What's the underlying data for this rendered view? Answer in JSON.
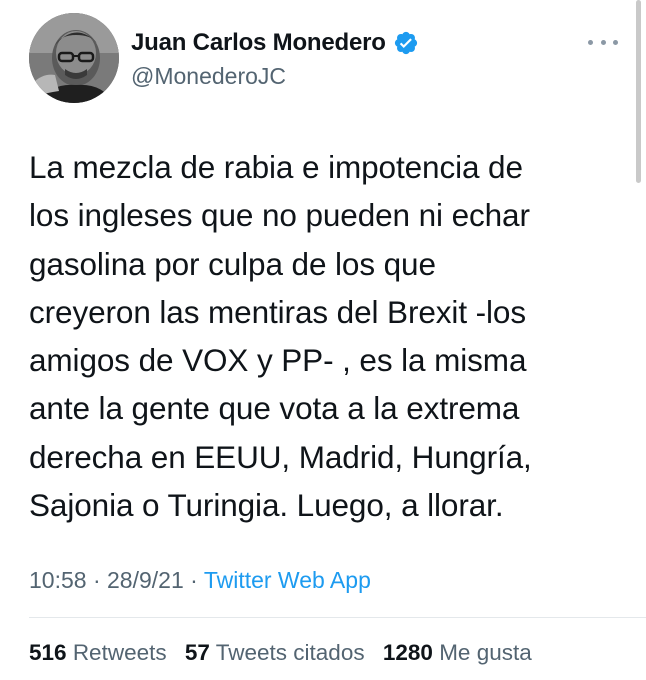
{
  "author": {
    "display_name": "Juan Carlos Monedero",
    "handle": "@MonederoJC",
    "avatar_icon": "profile-photo",
    "verified_icon": "verified-badge-icon",
    "verified_color": "#1d9bf0"
  },
  "menu_icon": "more-horizontal-icon",
  "tweet": {
    "text": "La mezcla de rabia e impotencia de\nlos ingleses que no pueden ni echar\ngasolina por culpa de los que\ncreyeron las mentiras del Brexit -los\namigos de VOX y PP- , es la misma\nante la gente que vota a la extrema\nderecha en EEUU, Madrid, Hungría,\nSajonia o Turingia. Luego, a llorar."
  },
  "meta": {
    "time": "10:58",
    "separator": "·",
    "date": "28/9/21",
    "source": "Twitter Web App"
  },
  "stats": {
    "retweets_count": "516",
    "retweets_label": "Retweets",
    "quotes_count": "57",
    "quotes_label": "Tweets citados",
    "likes_count": "1280",
    "likes_label": "Me gusta"
  },
  "colors": {
    "text": "#0f1419",
    "secondary": "#536471",
    "link": "#1d9bf0"
  }
}
